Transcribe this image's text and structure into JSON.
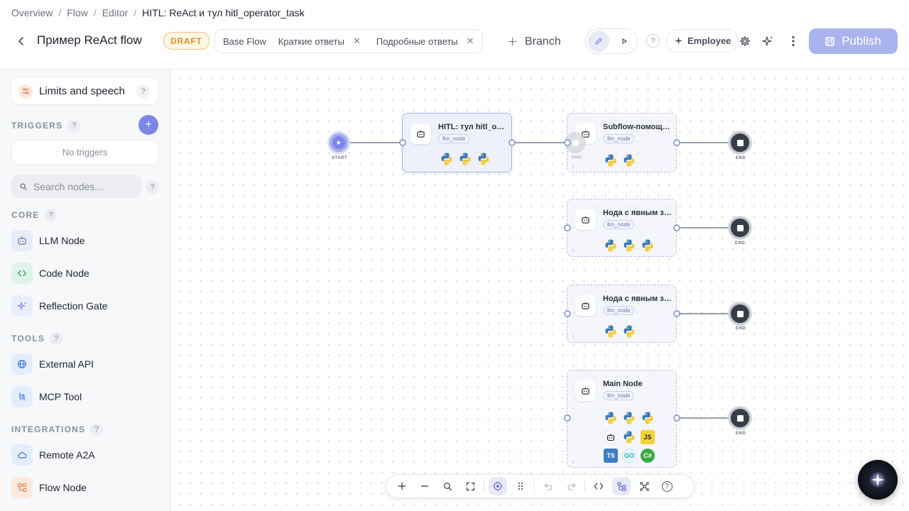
{
  "breadcrumb": [
    "Overview",
    "Flow",
    "Editor",
    "HITL: ReAct и тул hitl_operator_task"
  ],
  "header": {
    "title": "Пример ReAct flow",
    "status": "DRAFT",
    "branches": [
      {
        "label": "Base Flow",
        "closable": false
      },
      {
        "label": "Краткие ответы",
        "closable": true
      },
      {
        "label": "Подробные ответы",
        "closable": true
      }
    ],
    "add_branch_label": "Branch",
    "help": "?",
    "employee_label": "Employee",
    "publish_label": "Publish"
  },
  "sidebar": {
    "limits_label": "Limits and speech",
    "help": "?",
    "triggers_heading": "TRIGGERS",
    "add_trigger": "+",
    "no_triggers": "No triggers",
    "search_placeholder": "Search nodes...",
    "sections": [
      {
        "heading": "CORE",
        "items": [
          {
            "label": "LLM Node",
            "icon": "robot-icon"
          },
          {
            "label": "Code Node",
            "icon": "code-icon"
          },
          {
            "label": "Reflection Gate",
            "icon": "sparkle-icon"
          }
        ]
      },
      {
        "heading": "TOOLS",
        "items": [
          {
            "label": "External API",
            "icon": "globe-icon"
          },
          {
            "label": "MCP Tool",
            "icon": "mcp-icon"
          }
        ]
      },
      {
        "heading": "INTEGRATIONS",
        "items": [
          {
            "label": "Remote A2A",
            "icon": "cloud-icon"
          },
          {
            "label": "Flow Node",
            "icon": "flow-icon"
          }
        ]
      }
    ]
  },
  "canvas": {
    "start_label": "START",
    "end_label": "END",
    "end_label_alt": "END.",
    "node_type": "llm_node",
    "corner_marker": "↑",
    "nodes": [
      {
        "title": "HITL: тул hitl_operator_task",
        "tools": [
          "python",
          "python",
          "python"
        ]
      },
      {
        "title": "Subflow-помощник",
        "tools": [
          "python",
          "python"
        ]
      },
      {
        "title": "Нода с явным заданием",
        "tools": [
          "python",
          "python",
          "python"
        ]
      },
      {
        "title": "Нода с явным заданием",
        "tools": [
          "python",
          "python"
        ]
      },
      {
        "title": "Main Node",
        "tools": [
          "python",
          "python",
          "python",
          "robot",
          "python",
          "javascript",
          "typescript",
          "go",
          "csharp"
        ]
      }
    ],
    "tool_labels": {
      "javascript": "JS",
      "typescript": "TS",
      "go": "GO",
      "csharp": "C#"
    },
    "help": "?"
  },
  "colors": {
    "accent": "#7c86e8",
    "publish_bg": "#a9b4ee",
    "draft": "#d9921c",
    "node_border": "#b9bfe6",
    "end_node": "#3a3d47"
  }
}
